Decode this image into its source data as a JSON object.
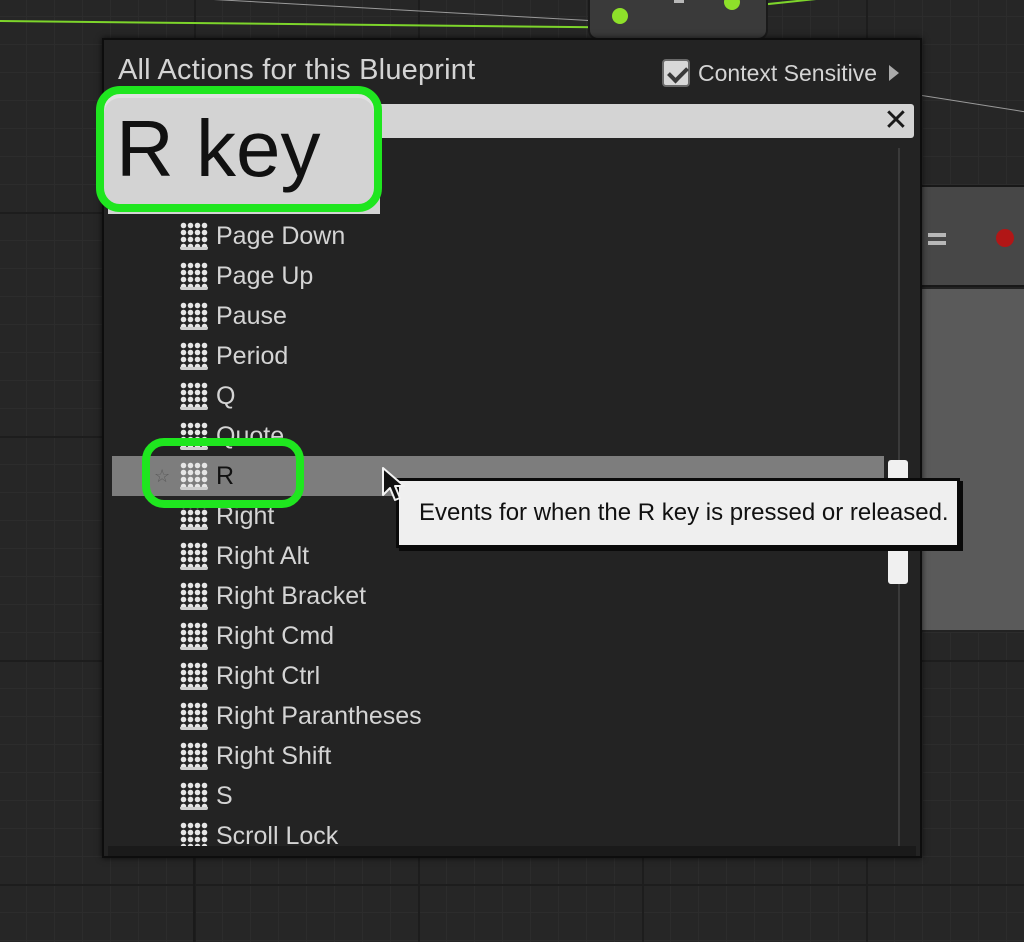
{
  "menu": {
    "title": "All Actions for this Blueprint",
    "context_sensitive_label": "Context Sensitive",
    "context_sensitive_checked": true
  },
  "search": {
    "value": "R key",
    "clear_glyph": "✕"
  },
  "list_items": [
    {
      "label": "Page Down",
      "icon": "key-icon"
    },
    {
      "label": "Page Up",
      "icon": "key-icon"
    },
    {
      "label": "Pause",
      "icon": "key-icon"
    },
    {
      "label": "Period",
      "icon": "key-icon"
    },
    {
      "label": "Q",
      "icon": "key-icon"
    },
    {
      "label": "Quote",
      "icon": "key-icon"
    },
    {
      "label": "R",
      "icon": "key-icon",
      "selected": true,
      "star_icon": "star-icon"
    },
    {
      "label": "Right",
      "icon": "key-icon"
    },
    {
      "label": "Right Alt",
      "icon": "key-icon"
    },
    {
      "label": "Right Bracket",
      "icon": "key-icon"
    },
    {
      "label": "Right Cmd",
      "icon": "key-icon"
    },
    {
      "label": "Right Ctrl",
      "icon": "key-icon"
    },
    {
      "label": "Right Parantheses",
      "icon": "key-icon"
    },
    {
      "label": "Right Shift",
      "icon": "key-icon"
    },
    {
      "label": "S",
      "icon": "key-icon"
    },
    {
      "label": "Scroll Lock",
      "icon": "key-icon"
    }
  ],
  "tooltip": {
    "text": "Events for when the R key is pressed or released."
  },
  "callout": {
    "text": "R key",
    "color": "#1fe61f"
  },
  "colors": {
    "accent_green": "#1fe61f",
    "selected_row": "#7d7d7d",
    "panel_bg": "#232323"
  }
}
